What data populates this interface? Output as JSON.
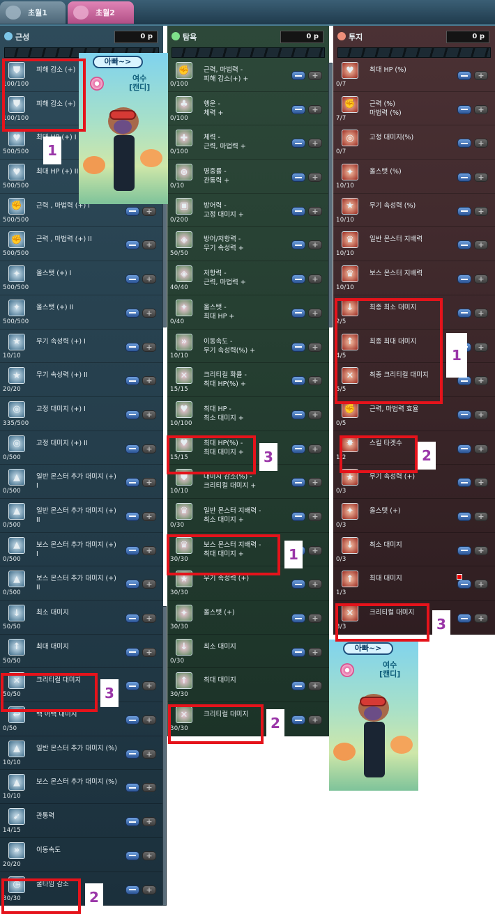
{
  "tabs": [
    {
      "label": "초월1"
    },
    {
      "label": "초월2"
    }
  ],
  "columns": [
    {
      "title": "근성",
      "points": "0 p",
      "rows": [
        {
          "name": "피해 감소 (+)",
          "level": "100/100",
          "icon": "shield"
        },
        {
          "name": "피해 감소 (+)",
          "level": "100/100",
          "icon": "shield"
        },
        {
          "name": "최대 HP (+) I",
          "level": "500/500",
          "icon": "hp"
        },
        {
          "name": "최대 HP (+) II",
          "level": "500/500",
          "icon": "hp"
        },
        {
          "name": "근력 , 마법력 (+) I",
          "level": "500/500",
          "icon": "power"
        },
        {
          "name": "근력 , 마법력 (+) II",
          "level": "500/500",
          "icon": "power"
        },
        {
          "name": "올스탯 (+) I",
          "level": "500/500",
          "icon": "allstat"
        },
        {
          "name": "올스탯 (+) II",
          "level": "500/500",
          "icon": "allstat"
        },
        {
          "name": "무기 속성력 (+) I",
          "level": "10/10",
          "icon": "star"
        },
        {
          "name": "무기 속성력 (+) II",
          "level": "20/20",
          "icon": "star"
        },
        {
          "name": "고정 대미지 (+) I",
          "level": "335/500",
          "icon": "fixed"
        },
        {
          "name": "고정 대미지 (+) II",
          "level": "0/500",
          "icon": "fixed"
        },
        {
          "name": "일반 몬스터 추가 대미지 (+)\nI",
          "level": "0/500",
          "icon": "up"
        },
        {
          "name": "일반 몬스터 추가 대미지 (+)\nII",
          "level": "0/500",
          "icon": "up"
        },
        {
          "name": "보스 몬스터 추가 대미지 (+)\nI",
          "level": "0/500",
          "icon": "up"
        },
        {
          "name": "보스 몬스터 추가 대미지 (+)\nII",
          "level": "0/500",
          "icon": "up"
        },
        {
          "name": "최소 대미지",
          "level": "50/50",
          "icon": "min"
        },
        {
          "name": "최대 대미지",
          "level": "50/50",
          "icon": "max"
        },
        {
          "name": "크리티컬 대미지",
          "level": "50/50",
          "icon": "crit"
        },
        {
          "name": "백 어택 대미지",
          "level": "0/50",
          "icon": "back"
        },
        {
          "name": "일반 몬스터 추가 대미지 (%)",
          "level": "10/10",
          "icon": "up"
        },
        {
          "name": "보스 몬스터 추가 대미지 (%)",
          "level": "10/10",
          "icon": "up"
        },
        {
          "name": "관통력",
          "level": "14/15",
          "icon": "pierce"
        },
        {
          "name": "이동속도",
          "level": "20/20",
          "icon": "speed"
        },
        {
          "name": "쿨타임 감소",
          "level": "30/30",
          "icon": "cooldown"
        }
      ]
    },
    {
      "title": "탐욕",
      "points": "0 p",
      "rows": [
        {
          "name": "근력, 마법력 -\n피해 감소(+) +",
          "level": "0/100",
          "icon": "power"
        },
        {
          "name": "행운 -\n체력 +",
          "level": "0/100",
          "icon": "luck"
        },
        {
          "name": "체력 -\n근력, 마법력 +",
          "level": "0/100",
          "icon": "vital"
        },
        {
          "name": "명중률 -\n관통력 +",
          "level": "0/10",
          "icon": "accuracy"
        },
        {
          "name": "방어력 -\n고정 대미지 +",
          "level": "0/200",
          "icon": "defense"
        },
        {
          "name": "방어/저항력 -\n무기 속성력 +",
          "level": "50/50",
          "icon": "resist"
        },
        {
          "name": "저항력 -\n근력, 마법력 +",
          "level": "40/40",
          "icon": "resist"
        },
        {
          "name": "올스탯 -\n최대 HP +",
          "level": "0/40",
          "icon": "allstat"
        },
        {
          "name": "이동속도 -\n무기 속성력(%) +",
          "level": "10/10",
          "icon": "speed"
        },
        {
          "name": "크리티컬 확률 -\n최대 HP(%) +",
          "level": "15/15",
          "icon": "crit"
        },
        {
          "name": "최대 HP -\n최소 대미지 +",
          "level": "10/100",
          "icon": "hp"
        },
        {
          "name": "최대 HP(%) -\n최대 대미지 +",
          "level": "15/15",
          "icon": "hp"
        },
        {
          "name": "대미지 감소(%) -\n크리티컬 대미지 +",
          "level": "10/10",
          "icon": "shield"
        },
        {
          "name": "일반 몬스터 지배력 -\n최소 대미지 +",
          "level": "0/30",
          "icon": "dominate"
        },
        {
          "name": "보스 몬스터 지배력 -\n최대 대미지 +",
          "level": "30/30",
          "icon": "dominate"
        },
        {
          "name": "무기 속성력 (+)",
          "level": "30/30",
          "icon": "star"
        },
        {
          "name": "올스탯 (+)",
          "level": "30/30",
          "icon": "allstat"
        },
        {
          "name": "최소 대미지",
          "level": "0/30",
          "icon": "min"
        },
        {
          "name": "최대 대미지",
          "level": "30/30",
          "icon": "max"
        },
        {
          "name": "크리티컬 대미지",
          "level": "30/30",
          "icon": "crit"
        }
      ]
    },
    {
      "title": "투지",
      "points": "0 p",
      "rows": [
        {
          "name": "최대 HP (%)",
          "level": "0/7",
          "icon": "hp"
        },
        {
          "name": "근력 (%)\n마법력 (%)",
          "level": "7/7",
          "icon": "power"
        },
        {
          "name": "고정 대미지(%)",
          "level": "0/7",
          "icon": "fixed"
        },
        {
          "name": "올스탯 (%)",
          "level": "10/10",
          "icon": "allstat"
        },
        {
          "name": "무기 속성력 (%)",
          "level": "10/10",
          "icon": "star"
        },
        {
          "name": "일반 몬스터 지배력",
          "level": "10/10",
          "icon": "dominate"
        },
        {
          "name": "보스 몬스터 지배력",
          "level": "10/10",
          "icon": "dominate"
        },
        {
          "name": "최종 최소 대미지",
          "level": "2/5",
          "icon": "min"
        },
        {
          "name": "최종 최대 대미지",
          "level": "4/5",
          "icon": "max"
        },
        {
          "name": "최종 크리티컬 대미지",
          "level": "5/5",
          "icon": "crit"
        },
        {
          "name": "근력, 마법력 효율",
          "level": "0/5",
          "icon": "power"
        },
        {
          "name": "스킬 타겟수",
          "level": "1/2",
          "icon": "target"
        },
        {
          "name": "무기 속성력 (+)",
          "level": "0/3",
          "icon": "star"
        },
        {
          "name": "올스탯 (+)",
          "level": "0/3",
          "icon": "allstat"
        },
        {
          "name": "최소 대미지",
          "level": "0/3",
          "icon": "min"
        },
        {
          "name": "최대 대미지",
          "level": "1/3",
          "icon": "max"
        },
        {
          "name": "크리티컬 대미지",
          "level": "3/3",
          "icon": "crit"
        }
      ]
    }
  ],
  "character_card": {
    "name_label": "아빠~>",
    "job_line1": "여수",
    "job_line2": "[캔디]"
  },
  "annotations": [
    "1",
    "1",
    "3",
    "2",
    "3",
    "1",
    "2",
    "1",
    "2",
    "3"
  ],
  "colors": {
    "highlight": "#e5131b",
    "annotation_text": "#9a36a8"
  }
}
